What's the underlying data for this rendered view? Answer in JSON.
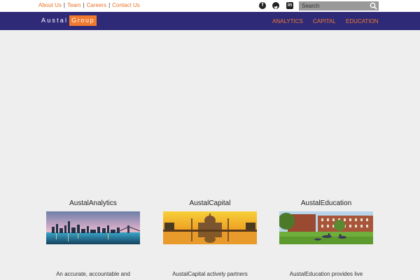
{
  "topbar": {
    "links": [
      "About Us",
      "Team",
      "Careers",
      "Contact Us"
    ],
    "separator": "|",
    "social": [
      "facebook-icon",
      "twitter-icon",
      "linkedin-icon"
    ],
    "search_placeholder": "Search"
  },
  "navbar": {
    "logo_left": "Austal",
    "logo_right": "Group",
    "items": [
      "ANALYTICS",
      "CAPITAL",
      "EDUCATION"
    ]
  },
  "cards": [
    {
      "title": "AustalAnalytics",
      "text": "An accurate, accountable and"
    },
    {
      "title": "AustalCapital",
      "text": "AustalCapital actively partners"
    },
    {
      "title": "AustalEducation",
      "text": "AustalEducation provides live"
    }
  ],
  "colors": {
    "accent": "#f07a2e",
    "navbar": "#2e2a78",
    "background": "#eeeeee"
  }
}
